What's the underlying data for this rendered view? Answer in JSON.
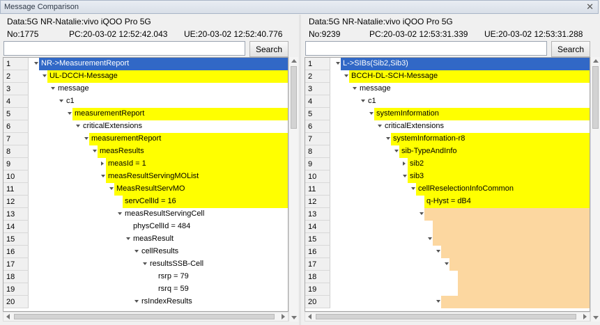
{
  "window": {
    "title": "Message Comparison",
    "close_glyph": "✕"
  },
  "search_label": "Search",
  "left": {
    "header_data": "Data:5G NR-Natalie:vivo iQOO Pro 5G",
    "no": "No:1775",
    "pc": "PC:20-03-02 12:52:42.043",
    "ue": "UE:20-03-02 12:52:40.776",
    "search_value": "",
    "rows": [
      {
        "n": "1",
        "text": "NR->MeasurementReport",
        "depth": 0,
        "exp": "down",
        "hl": "blue"
      },
      {
        "n": "2",
        "text": "UL-DCCH-Message",
        "depth": 1,
        "exp": "down",
        "hl": "yellow"
      },
      {
        "n": "3",
        "text": "message",
        "depth": 2,
        "exp": "down",
        "hl": ""
      },
      {
        "n": "4",
        "text": "c1",
        "depth": 3,
        "exp": "down",
        "hl": ""
      },
      {
        "n": "5",
        "text": "measurementReport",
        "depth": 4,
        "exp": "down",
        "hl": "yellow"
      },
      {
        "n": "6",
        "text": "criticalExtensions",
        "depth": 5,
        "exp": "down",
        "hl": ""
      },
      {
        "n": "7",
        "text": "measurementReport",
        "depth": 6,
        "exp": "down",
        "hl": "yellow"
      },
      {
        "n": "8",
        "text": "measResults",
        "depth": 7,
        "exp": "down",
        "hl": "yellow"
      },
      {
        "n": "9",
        "text": "measId = 1",
        "depth": 8,
        "exp": "right",
        "hl": "yellow"
      },
      {
        "n": "10",
        "text": "measResultServingMOList",
        "depth": 8,
        "exp": "down",
        "hl": "yellow"
      },
      {
        "n": "11",
        "text": "MeasResultServMO",
        "depth": 9,
        "exp": "down",
        "hl": "yellow"
      },
      {
        "n": "12",
        "text": "servCellId = 16",
        "depth": 10,
        "exp": "",
        "hl": "yellow"
      },
      {
        "n": "13",
        "text": "measResultServingCell",
        "depth": 10,
        "exp": "down",
        "hl": ""
      },
      {
        "n": "14",
        "text": "physCellId = 484",
        "depth": 11,
        "exp": "",
        "hl": ""
      },
      {
        "n": "15",
        "text": "measResult",
        "depth": 11,
        "exp": "down",
        "hl": ""
      },
      {
        "n": "16",
        "text": "cellResults",
        "depth": 12,
        "exp": "down",
        "hl": ""
      },
      {
        "n": "17",
        "text": "resultsSSB-Cell",
        "depth": 13,
        "exp": "down",
        "hl": ""
      },
      {
        "n": "18",
        "text": "rsrp = 79",
        "depth": 14,
        "exp": "",
        "hl": ""
      },
      {
        "n": "19",
        "text": "rsrq = 59",
        "depth": 14,
        "exp": "",
        "hl": ""
      },
      {
        "n": "20",
        "text": "rsIndexResults",
        "depth": 12,
        "exp": "down",
        "hl": ""
      }
    ]
  },
  "right": {
    "header_data": "Data:5G NR-Natalie:vivo iQOO Pro 5G",
    "no": "No:9239",
    "pc": "PC:20-03-02 12:53:31.339",
    "ue": "UE:20-03-02 12:53:31.288",
    "search_value": "",
    "rows": [
      {
        "n": "1",
        "text": "L->SIBs(Sib2,Sib3)",
        "depth": 0,
        "exp": "down",
        "hl": "blue"
      },
      {
        "n": "2",
        "text": "BCCH-DL-SCH-Message",
        "depth": 1,
        "exp": "down",
        "hl": "yellow"
      },
      {
        "n": "3",
        "text": "message",
        "depth": 2,
        "exp": "down",
        "hl": ""
      },
      {
        "n": "4",
        "text": "c1",
        "depth": 3,
        "exp": "down",
        "hl": ""
      },
      {
        "n": "5",
        "text": "systemInformation",
        "depth": 4,
        "exp": "down",
        "hl": "yellow"
      },
      {
        "n": "6",
        "text": "criticalExtensions",
        "depth": 5,
        "exp": "down",
        "hl": ""
      },
      {
        "n": "7",
        "text": "systemInformation-r8",
        "depth": 6,
        "exp": "down",
        "hl": "yellow"
      },
      {
        "n": "8",
        "text": "sib-TypeAndInfo",
        "depth": 7,
        "exp": "down",
        "hl": "yellow"
      },
      {
        "n": "9",
        "text": "sib2",
        "depth": 8,
        "exp": "right",
        "hl": "yellow"
      },
      {
        "n": "10",
        "text": "sib3",
        "depth": 8,
        "exp": "down",
        "hl": "yellow"
      },
      {
        "n": "11",
        "text": "cellReselectionInfoCommon",
        "depth": 9,
        "exp": "down",
        "hl": "yellow"
      },
      {
        "n": "12",
        "text": "q-Hyst = dB4",
        "depth": 10,
        "exp": "",
        "hl": "yellow"
      },
      {
        "n": "13",
        "text": "",
        "depth": 10,
        "exp": "down",
        "hl": "peach"
      },
      {
        "n": "14",
        "text": "",
        "depth": 11,
        "exp": "",
        "hl": "peach"
      },
      {
        "n": "15",
        "text": "",
        "depth": 11,
        "exp": "down",
        "hl": "peach"
      },
      {
        "n": "16",
        "text": "",
        "depth": 12,
        "exp": "down",
        "hl": "peach"
      },
      {
        "n": "17",
        "text": "",
        "depth": 13,
        "exp": "down",
        "hl": "peach"
      },
      {
        "n": "18",
        "text": "",
        "depth": 14,
        "exp": "",
        "hl": "peach"
      },
      {
        "n": "19",
        "text": "",
        "depth": 14,
        "exp": "",
        "hl": "peach"
      },
      {
        "n": "20",
        "text": "",
        "depth": 12,
        "exp": "down",
        "hl": "peach"
      }
    ]
  },
  "colors": {
    "highlight_yellow": "#ffff00",
    "highlight_blue": "#3168c6",
    "diff_peach": "#fcd7a0"
  },
  "icons": {
    "expanded": "triangle-down-icon",
    "collapsed": "triangle-right-icon"
  }
}
